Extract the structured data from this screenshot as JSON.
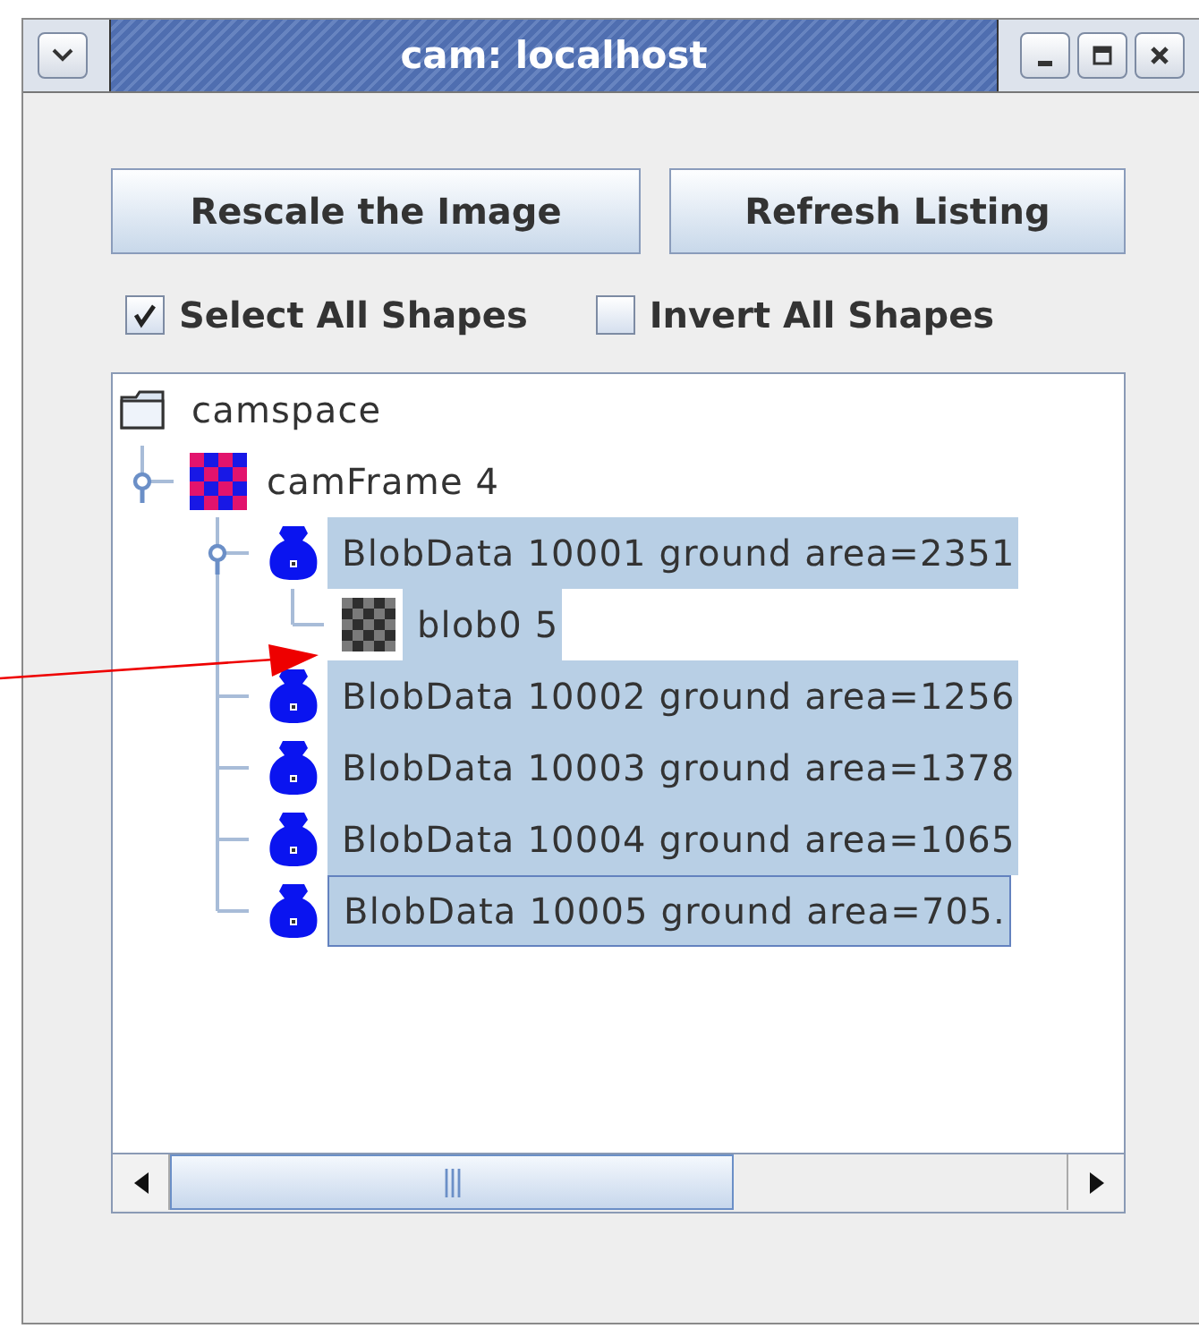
{
  "window": {
    "title": "cam: localhost"
  },
  "buttons": [
    "Rescale the Image",
    "Refresh Listing"
  ],
  "options": [
    {
      "label": "Select All Shapes",
      "checked": true
    },
    {
      "label": "Invert All Shapes",
      "checked": false
    }
  ],
  "tree": [
    {
      "label": "camspace",
      "kind": "folder",
      "selected": false,
      "children": [
        {
          "label": "camFrame 4",
          "kind": "frame",
          "selected": false,
          "expanded": true,
          "children": [
            {
              "label": "BlobData 10001 ground area=2351",
              "kind": "blob",
              "selected": true,
              "expanded": true,
              "children": [
                {
                  "label": "blob0 5",
                  "kind": "mask",
                  "selected": true
                }
              ]
            },
            {
              "label": "BlobData 10002 ground area=1256",
              "kind": "blob",
              "selected": true
            },
            {
              "label": "BlobData 10003 ground area=1378",
              "kind": "blob",
              "selected": true
            },
            {
              "label": "BlobData 10004 ground area=1065",
              "kind": "blob",
              "selected": true
            },
            {
              "label": "BlobData 10005 ground area=705.",
              "kind": "blob",
              "selected": true,
              "focused": true
            }
          ]
        }
      ]
    }
  ]
}
